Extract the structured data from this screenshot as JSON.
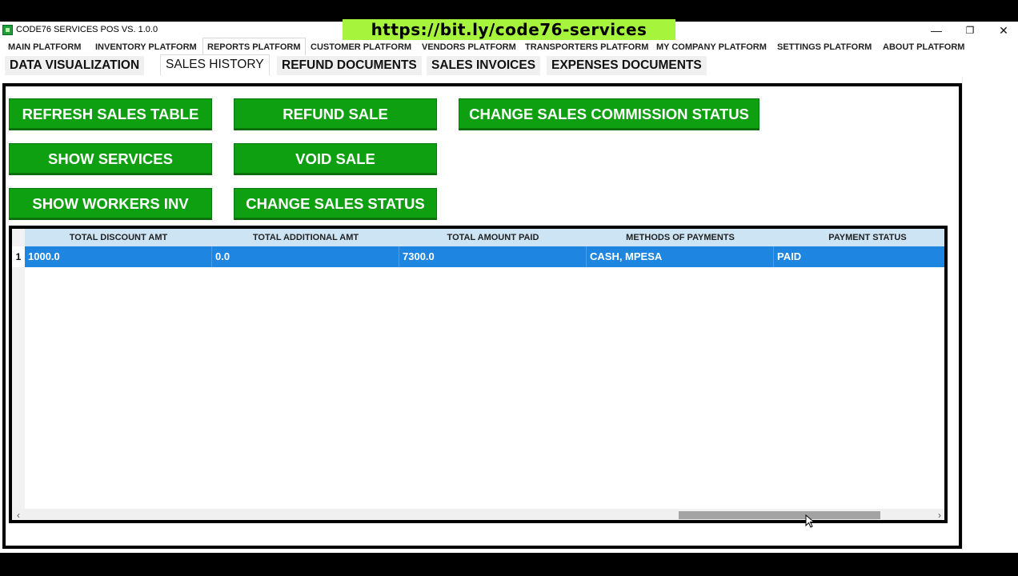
{
  "window": {
    "title": "CODE76 SERVICES POS VS. 1.0.0",
    "banner_url": "https://bit.ly/code76-services",
    "controls": {
      "minimize": "—",
      "restore": "❐",
      "close": "✕"
    }
  },
  "platform_tabs": [
    {
      "label": "MAIN PLATFORM"
    },
    {
      "label": "INVENTORY PLATFORM"
    },
    {
      "label": "REPORTS PLATFORM",
      "active": true
    },
    {
      "label": "CUSTOMER PLATFORM"
    },
    {
      "label": "VENDORS PLATFORM"
    },
    {
      "label": "TRANSPORTERS PLATFORM"
    },
    {
      "label": "MY COMPANY PLATFORM"
    },
    {
      "label": "SETTINGS PLATFORM"
    },
    {
      "label": "ABOUT PLATFORM"
    }
  ],
  "sub_tabs": [
    {
      "label": "DATA VISUALIZATION"
    },
    {
      "label": "SALES HISTORY",
      "active": true
    },
    {
      "label": "REFUND DOCUMENTS"
    },
    {
      "label": "SALES INVOICES"
    },
    {
      "label": "EXPENSES DOCUMENTS"
    }
  ],
  "buttons": {
    "refresh_sales_table": "REFRESH SALES TABLE",
    "refund_sale": "REFUND SALE",
    "change_sales_commission_status": "CHANGE SALES COMMISSION STATUS",
    "show_services": "SHOW SERVICES",
    "void_sale": "VOID SALE",
    "show_workers_inv": "SHOW WORKERS INV",
    "change_sales_status": "CHANGE SALES STATUS"
  },
  "table": {
    "columns": [
      "TOTAL DISCOUNT AMT",
      "TOTAL ADDITIONAL AMT",
      "TOTAL AMOUNT PAID",
      "METHODS OF PAYMENTS",
      "PAYMENT STATUS"
    ],
    "rows": [
      {
        "num": "1",
        "cells": [
          "1000.0",
          "0.0",
          "7300.0",
          "CASH, MPESA",
          "PAID"
        ]
      }
    ],
    "scroll_left": "‹",
    "scroll_right": "›"
  },
  "colors": {
    "button_green": "#0fa012",
    "selected_row": "#1e86e0",
    "header_blue": "#cde4f5",
    "banner_green": "#a6f53c"
  }
}
